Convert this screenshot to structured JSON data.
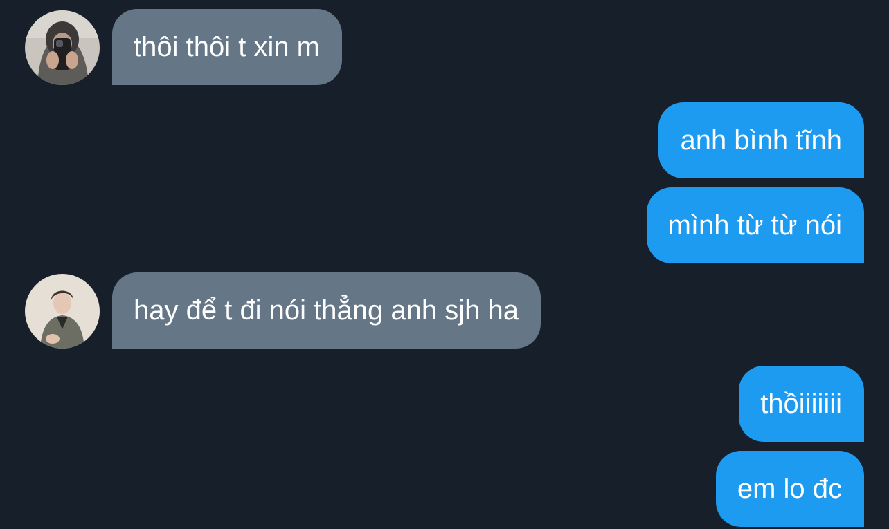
{
  "conversation": {
    "messages": [
      {
        "sender": "them",
        "text": "thôi thôi t xin m"
      },
      {
        "sender": "me",
        "text": "anh bình tĩnh"
      },
      {
        "sender": "me",
        "text": "mình từ từ nói"
      },
      {
        "sender": "them",
        "text": "hay để t đi nói thẳng anh sjh ha"
      },
      {
        "sender": "me",
        "text": "thồiiiiiii"
      },
      {
        "sender": "me",
        "text": "em lo đc"
      }
    ]
  },
  "colors": {
    "background": "#17202a",
    "incoming_bubble": "#657786",
    "outgoing_bubble": "#1d9bf0",
    "text": "#ffffff"
  },
  "icons": {
    "avatar_1": "avatar-mirror-selfie-icon",
    "avatar_2": "avatar-person-jacket-icon"
  }
}
